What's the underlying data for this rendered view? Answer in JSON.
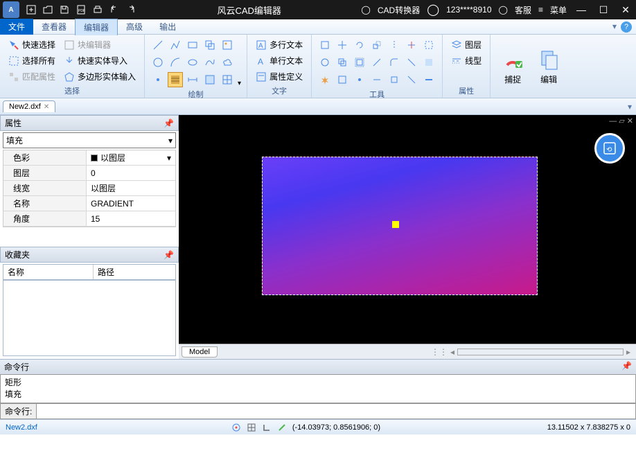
{
  "titlebar": {
    "title": "风云CAD编辑器",
    "converter": "CAD转换器",
    "user": "123****8910",
    "support": "客服",
    "menu": "菜单"
  },
  "menus": {
    "file": "文件",
    "viewer": "查看器",
    "editor": "编辑器",
    "advanced": "高级",
    "output": "输出"
  },
  "ribbon": {
    "select": {
      "label": "选择",
      "quick": "快速选择",
      "all": "选择所有",
      "match": "匹配属性",
      "blockedit": "块编辑器",
      "entimport": "快速实体导入",
      "polyinput": "多边形实体输入"
    },
    "draw": {
      "label": "绘制"
    },
    "text": {
      "label": "文字",
      "mtext": "多行文本",
      "stext": "单行文本",
      "attdef": "属性定义"
    },
    "tools": {
      "label": "工具"
    },
    "props": {
      "label": "属性",
      "layer": "图层",
      "ltype": "线型"
    },
    "snap": "捕捉",
    "edit": "编辑"
  },
  "file_tab": "New2.dxf",
  "prop_panel": {
    "title": "属性",
    "type": "填充",
    "rows": [
      {
        "k": "色彩",
        "v": "以图层"
      },
      {
        "k": "图层",
        "v": "0"
      },
      {
        "k": "线宽",
        "v": "以图层"
      },
      {
        "k": "名称",
        "v": "GRADIENT"
      },
      {
        "k": "角度",
        "v": "15"
      }
    ]
  },
  "fav_panel": {
    "title": "收藏夹",
    "col1": "名称",
    "col2": "路径"
  },
  "model_tab": "Model",
  "cmd": {
    "title": "命令行",
    "log1": "矩形",
    "log2": "填充",
    "label": "命令行:"
  },
  "status": {
    "file": "New2.dxf",
    "coords": "(-14.03973; 0.8561906; 0)",
    "right": "13.11502 x 7.838275 x 0"
  }
}
